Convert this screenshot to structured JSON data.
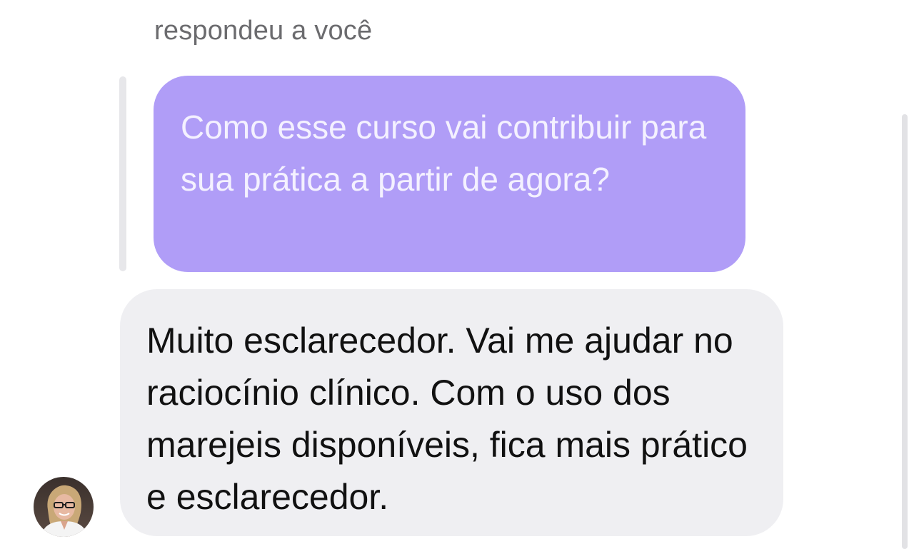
{
  "reply": {
    "header": "respondeu a você",
    "quoted_message": "Como esse curso vai contribuir para sua prática a partir de agora?",
    "quoted_bubble_color": "#b09df7"
  },
  "message": {
    "text": "Muito esclarecedor. Vai me ajudar no raciocínio clínico. Com o uso dos marejeis disponíveis, fica mais prático e esclarecedor.",
    "bubble_color": "#efeff2"
  },
  "avatar": {
    "icon": "profile-photo-avatar"
  }
}
